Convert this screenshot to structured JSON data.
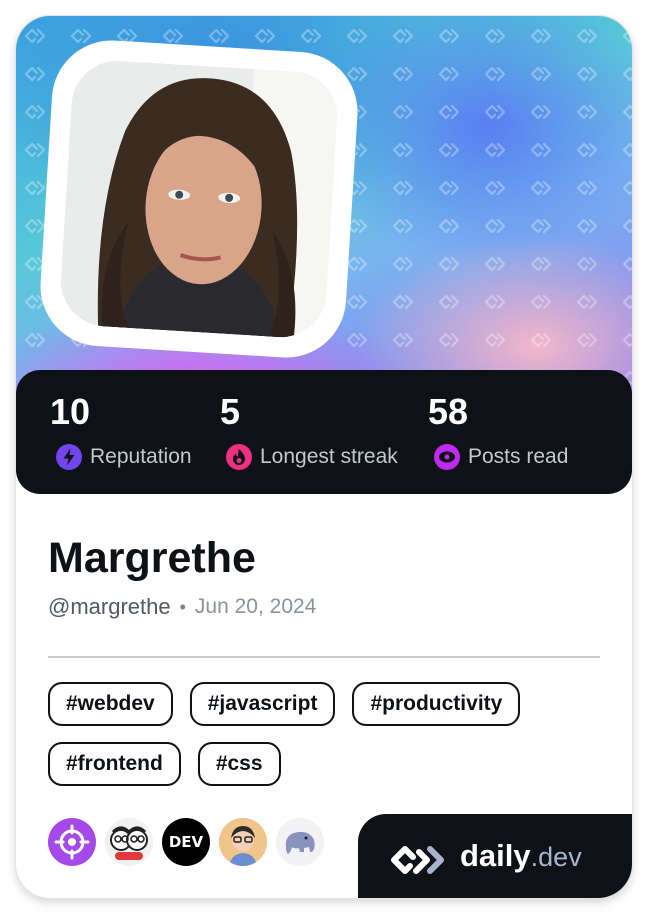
{
  "profile": {
    "name": "Margrethe",
    "handle": "@margrethe",
    "separator": "•",
    "joined": "Jun 20, 2024"
  },
  "stats": [
    {
      "value": "10",
      "label": "Reputation",
      "icon": "bolt-icon",
      "color": "#7147ed"
    },
    {
      "value": "5",
      "label": "Longest streak",
      "icon": "flame-icon",
      "color": "#ef2f7f"
    },
    {
      "value": "58",
      "label": "Posts read",
      "icon": "eye-icon",
      "color": "#c029f0"
    }
  ],
  "tags": [
    [
      "#webdev",
      "#javascript",
      "#productivity"
    ],
    [
      "#frontend",
      "#css"
    ]
  ],
  "sources": [
    {
      "name": "target-icon",
      "color": "#a54ae8"
    },
    {
      "name": "cartoon-faces-icon",
      "color": "#f1f1f1"
    },
    {
      "name": "dev-logo",
      "text": "DEV",
      "color": "#000000"
    },
    {
      "name": "avatar-glasses-icon",
      "color": "#f0c48a"
    },
    {
      "name": "elephant-icon",
      "color": "#f2f2f4"
    }
  ],
  "brand": {
    "name": "daily",
    "tld": ".dev"
  },
  "colors": {
    "dark": "#0e1217",
    "accent": "#7147ed"
  }
}
